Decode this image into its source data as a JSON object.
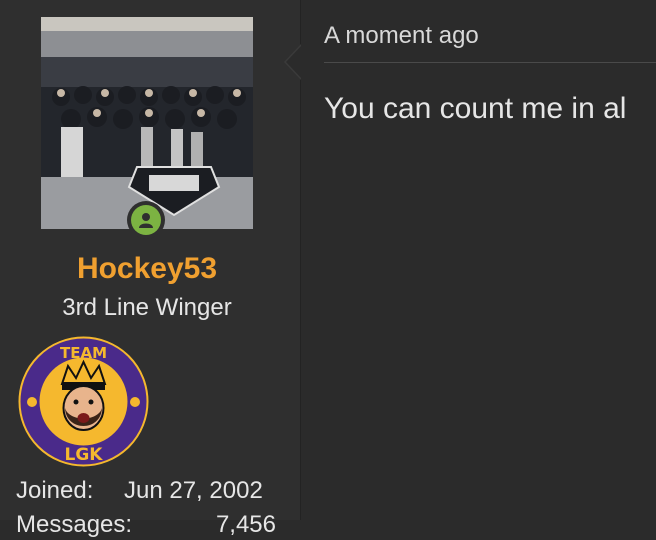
{
  "user": {
    "username": "Hockey53",
    "rank": "3rd Line Winger",
    "badge_text_top": "TEAM",
    "badge_text_bottom": "LGK",
    "stats": [
      {
        "label": "Joined:",
        "value": "Jun 27, 2002"
      },
      {
        "label": "Messages:",
        "value": "7,456"
      }
    ]
  },
  "post": {
    "time": "A moment ago",
    "body": "You can count me in al"
  },
  "colors": {
    "username": "#f0a030",
    "online": "#7cb342",
    "badge_purple": "#4a2a8a",
    "badge_gold": "#f5b82e"
  },
  "icons": {
    "online_status": "user-online-icon",
    "avatar": "team-photo-avatar"
  }
}
